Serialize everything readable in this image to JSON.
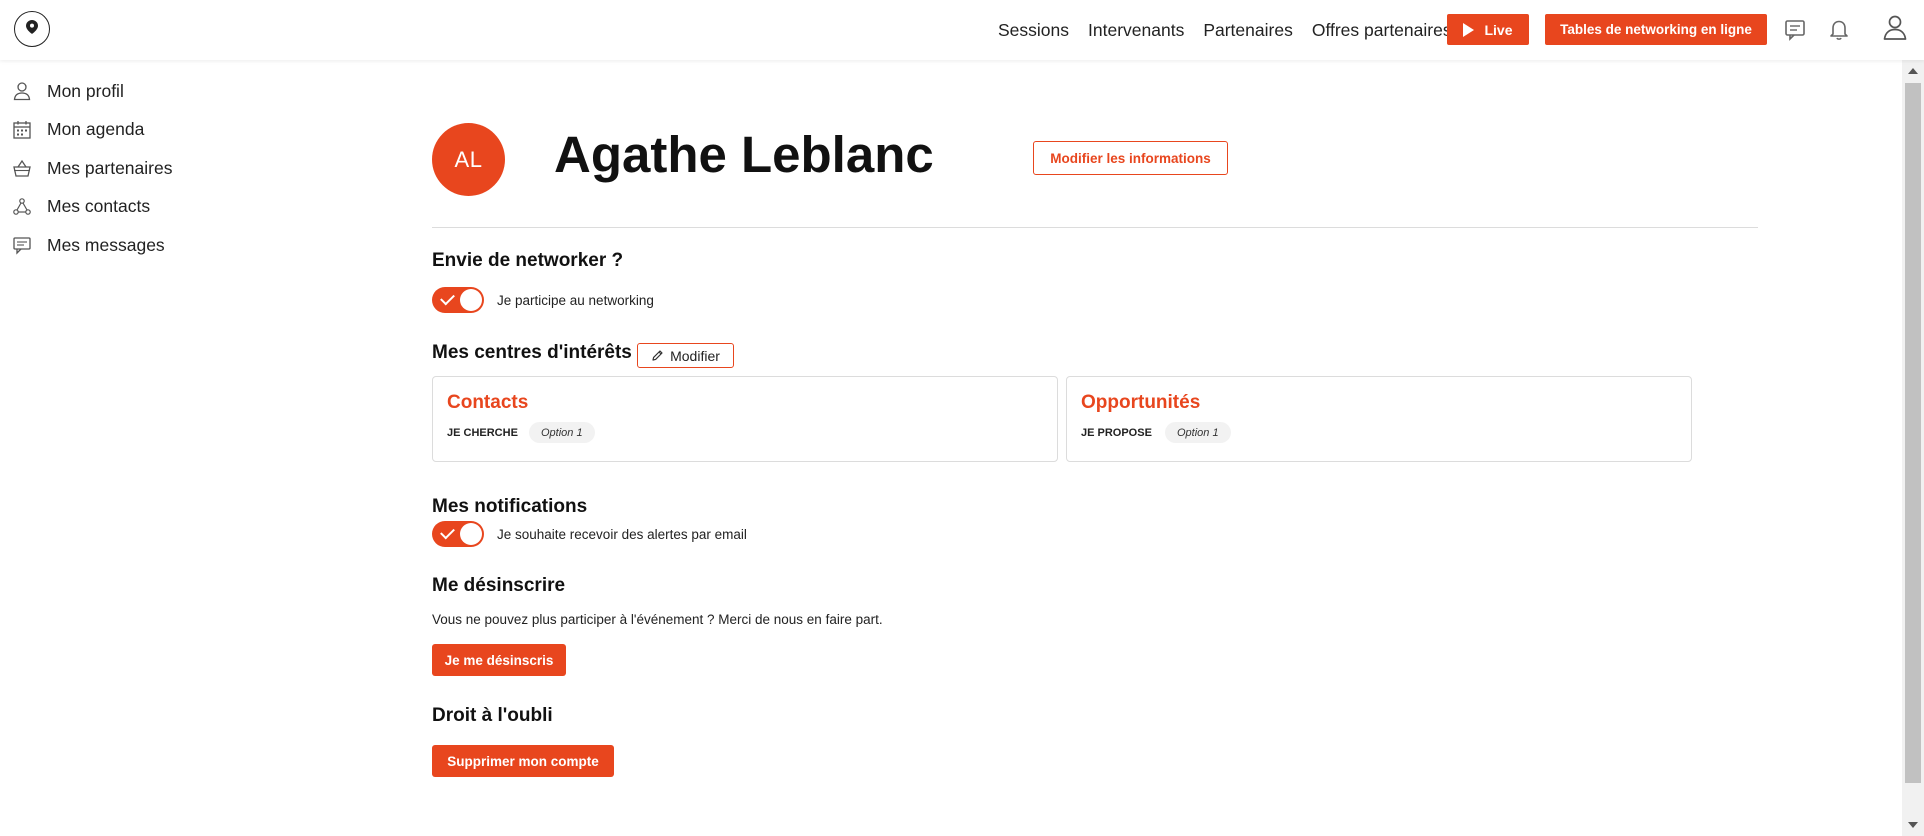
{
  "header": {
    "nav": [
      "Sessions",
      "Intervenants",
      "Partenaires",
      "Offres partenaires"
    ],
    "live_label": "Live",
    "tables_label": "Tables de networking en ligne",
    "icons": [
      "messages-icon",
      "bell-icon",
      "user-icon"
    ],
    "accent": "#e8461e"
  },
  "sidebar": {
    "items": [
      {
        "label": "Mon profil",
        "icon": "user-icon"
      },
      {
        "label": "Mon agenda",
        "icon": "calendar-icon"
      },
      {
        "label": "Mes partenaires",
        "icon": "basket-icon"
      },
      {
        "label": "Mes contacts",
        "icon": "network-icon"
      },
      {
        "label": "Mes messages",
        "icon": "message-icon"
      }
    ]
  },
  "profile": {
    "initials": "AL",
    "name": "Agathe Leblanc",
    "modify_label": "Modifier les informations"
  },
  "networking": {
    "title": "Envie de networker ?",
    "toggle_label": "Je participe au networking",
    "enabled": true
  },
  "interests": {
    "title": "Mes centres d'intérêts",
    "edit_label": "Modifier",
    "cards": [
      {
        "title": "Contacts",
        "tag_label": "JE CHERCHE",
        "chip": "Option 1"
      },
      {
        "title": "Opportunités",
        "tag_label": "JE PROPOSE",
        "chip": "Option 1"
      }
    ]
  },
  "notifications": {
    "title": "Mes notifications",
    "toggle_label": "Je souhaite recevoir des alertes par email",
    "enabled": true
  },
  "unsubscribe": {
    "title": "Me désinscrire",
    "text": "Vous ne pouvez plus participer à l'événement ? Merci de nous en faire part.",
    "button": "Je me désinscris"
  },
  "forget": {
    "title": "Droit à l'oubli",
    "button": "Supprimer mon compte"
  }
}
